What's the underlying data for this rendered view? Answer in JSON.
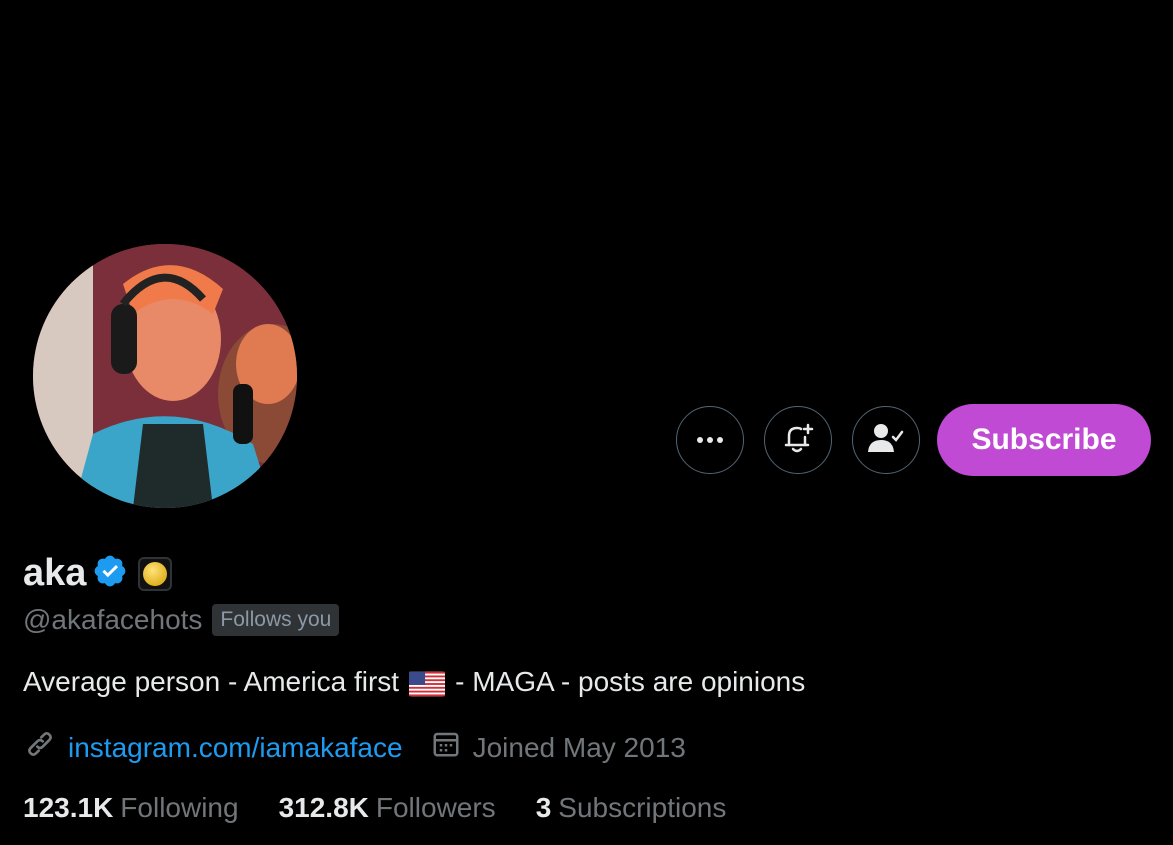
{
  "profile": {
    "display_name": "aka",
    "handle": "@akafacehots",
    "follows_you": "Follows you",
    "bio_part1": "Average person - America first",
    "bio_part2": "- MAGA - posts are opinions",
    "link": "instagram.com/iamakaface",
    "joined": "Joined May 2013"
  },
  "stats": [
    {
      "value": "123.1K",
      "label": "Following"
    },
    {
      "value": "312.8K",
      "label": "Followers"
    },
    {
      "value": "3",
      "label": "Subscriptions"
    }
  ],
  "actions": {
    "subscribe_label": "Subscribe"
  },
  "icons": {
    "more": "more-icon",
    "notify": "bell-plus-icon",
    "following": "person-check-icon",
    "verified": "verified-badge-icon",
    "link": "link-icon",
    "calendar": "calendar-icon"
  },
  "colors": {
    "background": "#000000",
    "accent_subscribe": "#c04ad4",
    "link": "#1d9bf0",
    "secondary_text": "#71767b",
    "verified": "#1d9bf0"
  }
}
